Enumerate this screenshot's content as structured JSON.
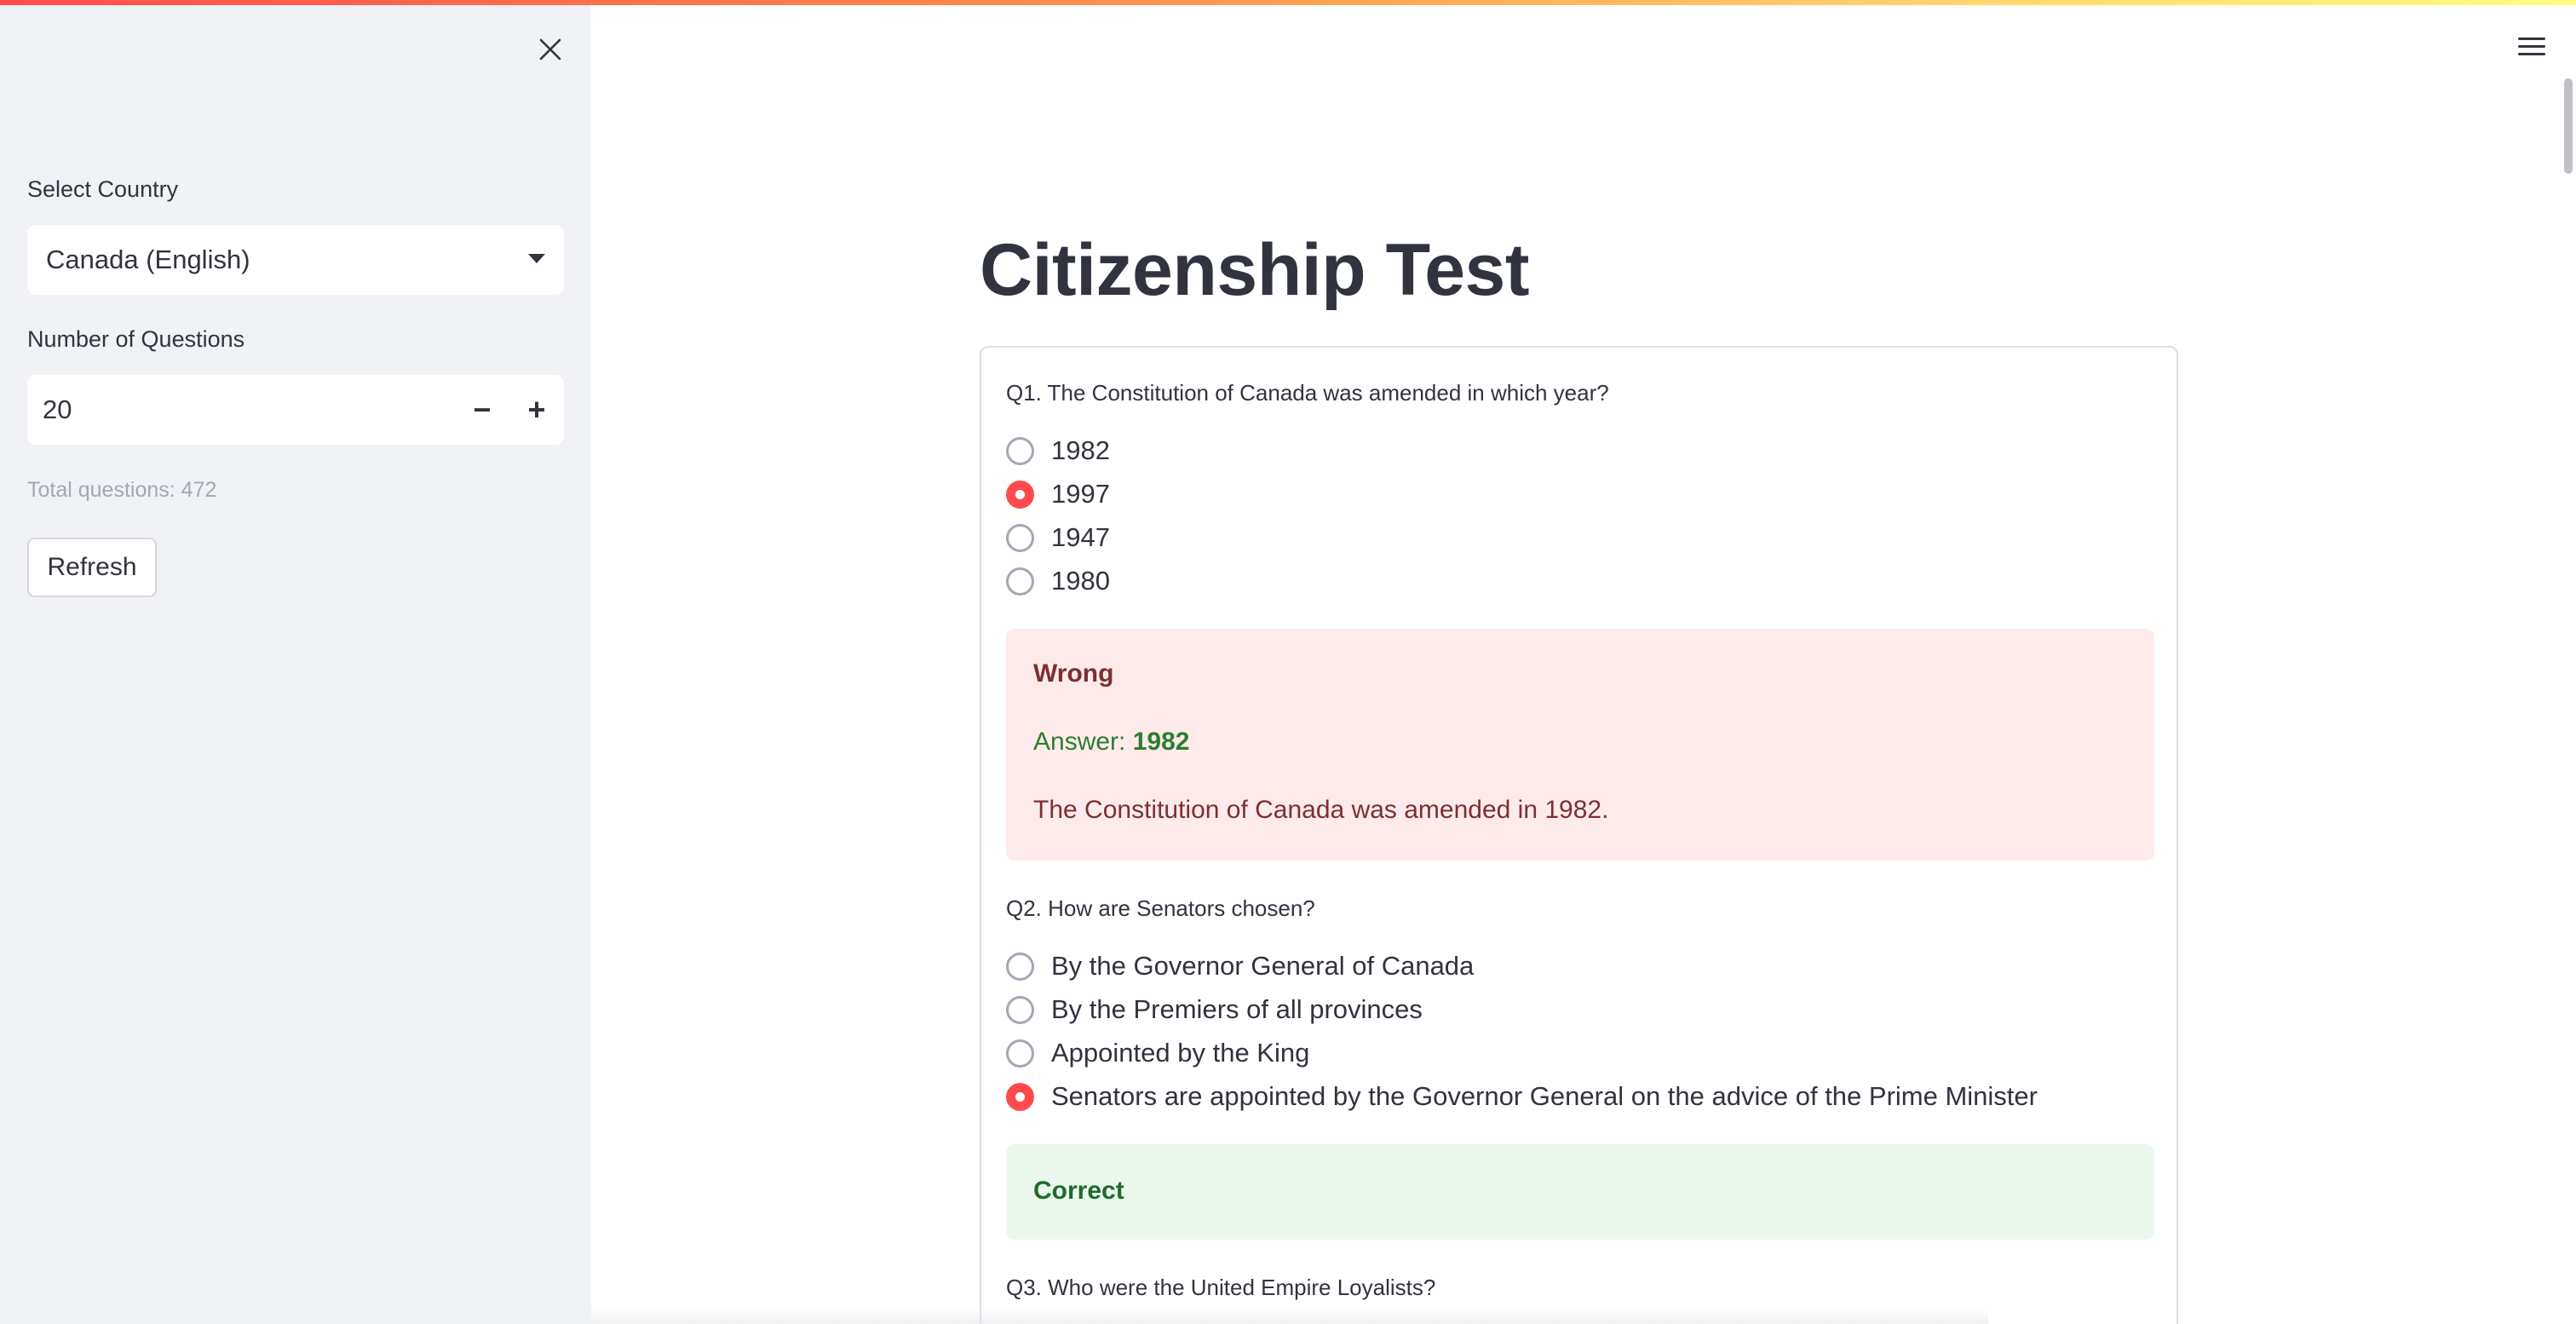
{
  "sidebar": {
    "country_label": "Select Country",
    "country_value": "Canada (English)",
    "questions_label": "Number of Questions",
    "questions_value": "20",
    "minus": "−",
    "plus": "+",
    "total_text": "Total questions: 472",
    "refresh_label": "Refresh"
  },
  "main": {
    "title": "Citizenship Test",
    "questions": [
      {
        "text": "Q1. The Constitution of Canada was amended in which year?",
        "options": [
          "1982",
          "1997",
          "1947",
          "1980"
        ],
        "selected": 1,
        "feedback": {
          "status": "Wrong",
          "answer_prefix": "Answer: ",
          "answer_value": "1982",
          "explanation": "The Constitution of Canada was amended in 1982."
        }
      },
      {
        "text": "Q2. How are Senators chosen?",
        "options": [
          "By the Governor General of Canada",
          "By the Premiers of all provinces",
          "Appointed by the King",
          "Senators are appointed by the Governor General on the advice of the Prime Minister"
        ],
        "selected": 3,
        "feedback": {
          "status": "Correct"
        }
      },
      {
        "text": "Q3. Who were the United Empire Loyalists?"
      }
    ]
  },
  "colors": {
    "accent": "#ff4b4b",
    "sidebar_bg": "#f0f2f6",
    "wrong_bg": "#fdebeb",
    "correct_bg": "#ecf8ee",
    "answer_green": "#2e7d32"
  },
  "icons": {
    "close": "close-icon",
    "menu": "hamburger-menu-icon",
    "dropdown": "chevron-down-icon"
  }
}
